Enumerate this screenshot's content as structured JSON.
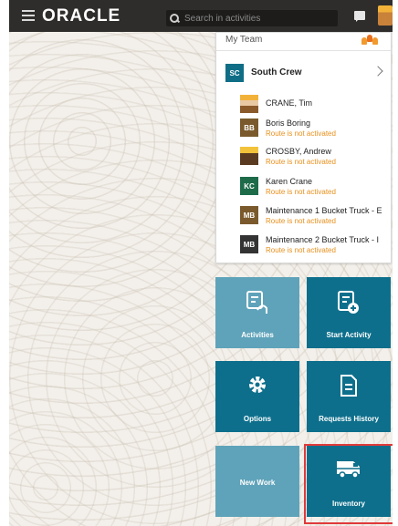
{
  "header": {
    "brand": "ORACLE",
    "search_placeholder": "Search in activities"
  },
  "team": {
    "title": "My Team",
    "crew": {
      "initials": "SC",
      "name": "South Crew"
    },
    "members": [
      {
        "name": "CRANE, Tim",
        "status": "",
        "photo": "photo"
      },
      {
        "name": "Boris Boring",
        "status": "Route is not activated",
        "initials": "BB",
        "color": "#7a5a2c"
      },
      {
        "name": "CROSBY, Andrew",
        "status": "Route is not activated",
        "photo": "photo"
      },
      {
        "name": "Karen Crane",
        "status": "Route is not activated",
        "initials": "KC",
        "color": "#1e6b4a"
      },
      {
        "name": "Maintenance 1 Bucket Truck - E",
        "status": "Route is not activated",
        "initials": "MB",
        "color": "#7a5a2c"
      },
      {
        "name": "Maintenance 2 Bucket Truck - I",
        "status": "Route is not activated",
        "initials": "MB",
        "color": "#333333"
      }
    ]
  },
  "tiles": {
    "activities": "Activities",
    "start_activity": "Start Activity",
    "options": "Options",
    "requests_history": "Requests History",
    "new_work": "New Work",
    "inventory": "Inventory"
  },
  "colors": {
    "tile_light": "#5fa3ba",
    "tile_dark": "#0d6f8c",
    "status_orange": "#e8901c",
    "highlight": "#e03a3a"
  }
}
